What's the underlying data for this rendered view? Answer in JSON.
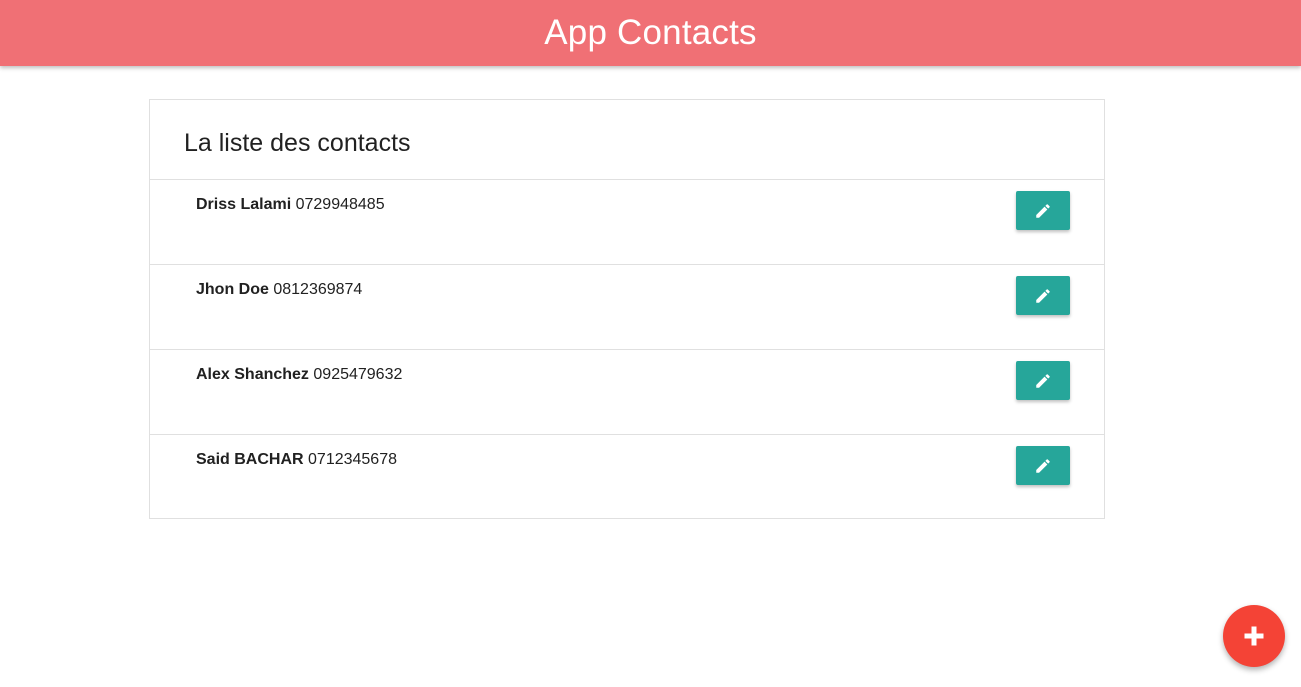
{
  "header": {
    "title": "App Contacts",
    "background_color": "#f07075"
  },
  "card": {
    "title": "La liste des contacts"
  },
  "contacts": [
    {
      "name": "Driss Lalami",
      "phone": "0729948485",
      "edit_icon": "pencil-icon"
    },
    {
      "name": "Jhon Doe",
      "phone": "0812369874",
      "edit_icon": "pencil-icon"
    },
    {
      "name": "Alex Shanchez",
      "phone": "0925479632",
      "edit_icon": "pencil-icon"
    },
    {
      "name": "Said BACHAR",
      "phone": "0712345678",
      "edit_icon": "pencil-icon"
    }
  ],
  "colors": {
    "edit_button": "#26a69a",
    "fab": "#f44336"
  },
  "fab": {
    "icon": "plus-icon"
  }
}
